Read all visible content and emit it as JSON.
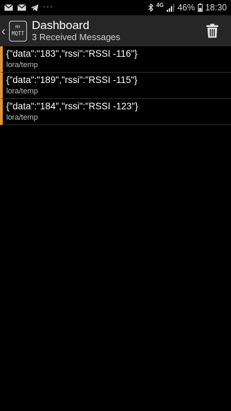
{
  "status_bar": {
    "left_icons": [
      "mail-icon",
      "mail-icon",
      "telegram-icon",
      "more-dots-icon"
    ],
    "dots": "···",
    "right_icons": [
      "bluetooth-icon",
      "signal-icon",
      "battery-icon"
    ],
    "network": "4G",
    "battery": "46%",
    "time": "18:30"
  },
  "app_bar": {
    "logo_top": "MY",
    "logo_bottom": "MQTT",
    "title": "Dashboard",
    "subtitle": "3 Received Messages",
    "accent_color": "#e0953a"
  },
  "messages": [
    {
      "payload": "{\"data\":\"183\",\"rssi\":\"RSSI -116\"}",
      "topic": "lora/temp"
    },
    {
      "payload": "{\"data\":\"189\",\"rssi\":\"RSSI -115\"}",
      "topic": "lora/temp"
    },
    {
      "payload": "{\"data\":\"184\",\"rssi\":\"RSSI -123\"}",
      "topic": "lora/temp"
    }
  ]
}
